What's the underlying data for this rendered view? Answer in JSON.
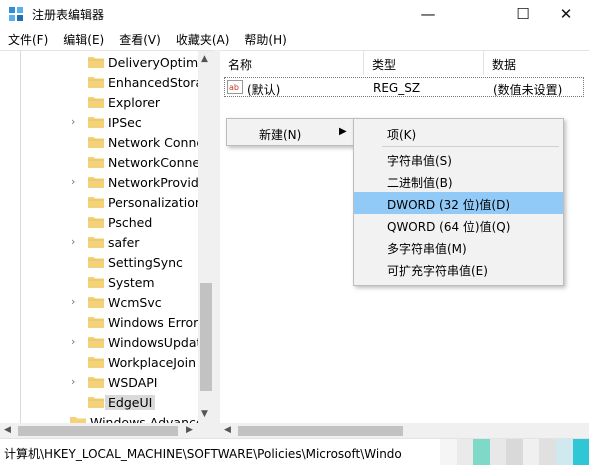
{
  "window": {
    "title": "注册表编辑器",
    "minimize_glyph": "—",
    "maximize_glyph": "☐",
    "close_glyph": "✕"
  },
  "menubar": [
    "文件(F)",
    "编辑(E)",
    "查看(V)",
    "收藏夹(A)",
    "帮助(H)"
  ],
  "tree": {
    "items": [
      {
        "label": "DeliveryOptimiz",
        "expandable": false
      },
      {
        "label": "EnhancedStorag",
        "expandable": false
      },
      {
        "label": "Explorer",
        "expandable": false
      },
      {
        "label": "IPSec",
        "expandable": true
      },
      {
        "label": "Network Conne",
        "expandable": false
      },
      {
        "label": "NetworkConne",
        "expandable": false
      },
      {
        "label": "NetworkProvide",
        "expandable": true
      },
      {
        "label": "Personalization",
        "expandable": false
      },
      {
        "label": "Psched",
        "expandable": false
      },
      {
        "label": "safer",
        "expandable": true
      },
      {
        "label": "SettingSync",
        "expandable": false
      },
      {
        "label": "System",
        "expandable": false
      },
      {
        "label": "WcmSvc",
        "expandable": true
      },
      {
        "label": "Windows Error",
        "expandable": false
      },
      {
        "label": "WindowsUpdat",
        "expandable": true
      },
      {
        "label": "WorkplaceJoin",
        "expandable": false
      },
      {
        "label": "WSDAPI",
        "expandable": true
      },
      {
        "label": "EdgeUI",
        "expandable": false,
        "selected": true
      }
    ],
    "partial_item": "Windows Advance"
  },
  "list": {
    "columns": [
      "名称",
      "类型",
      "数据"
    ],
    "rows": [
      {
        "name": "(默认)",
        "type": "REG_SZ",
        "data": "(数值未设置)",
        "icon": "ab-string-icon"
      }
    ]
  },
  "context_menu": {
    "parent_label": "新建(N)",
    "submenu": [
      {
        "label": "项(K)",
        "highlight": false
      },
      {
        "label": "字符串值(S)",
        "highlight": false
      },
      {
        "label": "二进制值(B)",
        "highlight": false
      },
      {
        "label": "DWORD (32 位)值(D)",
        "highlight": true
      },
      {
        "label": "QWORD (64 位)值(Q)",
        "highlight": false
      },
      {
        "label": "多字符串值(M)",
        "highlight": false
      },
      {
        "label": "可扩充字符串值(E)",
        "highlight": false
      }
    ],
    "highlight_color": "#91c9f7"
  },
  "statusbar": {
    "path": "计算机\\HKEY_LOCAL_MACHINE\\SOFTWARE\\Policies\\Microsoft\\Windo"
  },
  "colors": {
    "folder": "#f3d27a",
    "selection": "#d9d9d9",
    "highlight": "#91c9f7",
    "mosaic": [
      "#f5f5f5",
      "#eaeaea",
      "#7fd9c8",
      "#e8e8e8",
      "#d9d9d9",
      "#f0f0f0",
      "#e0e0e0",
      "#cfe9ee",
      "#2fc7d6"
    ]
  }
}
